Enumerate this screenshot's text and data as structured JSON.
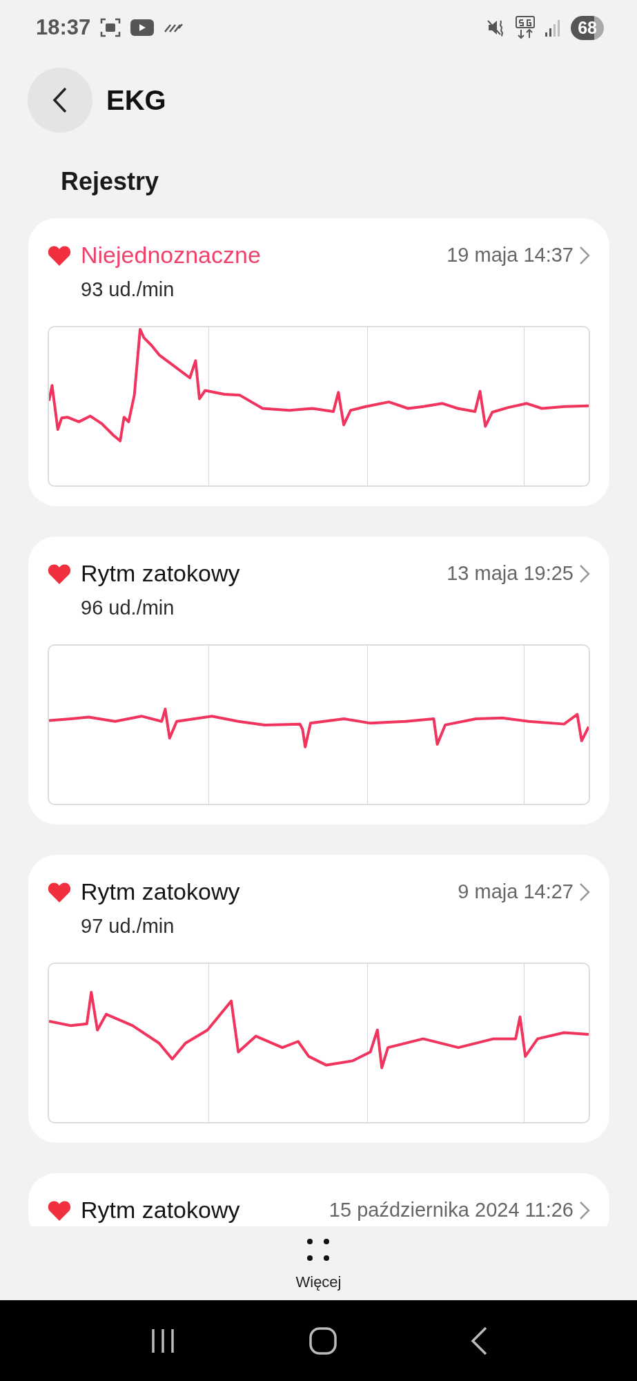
{
  "status_bar": {
    "time": "18:37",
    "battery": "68"
  },
  "header": {
    "title": "EKG"
  },
  "section_title": "Rejestry",
  "records": [
    {
      "highlighted": true,
      "title": "Niejednoznaczne",
      "date": "19 maja 14:37",
      "rate": "93 ud./min"
    },
    {
      "highlighted": false,
      "title": "Rytm zatokowy",
      "date": "13 maja 19:25",
      "rate": "96 ud./min"
    },
    {
      "highlighted": false,
      "title": "Rytm zatokowy",
      "date": "9 maja 14:27",
      "rate": "97 ud./min"
    },
    {
      "highlighted": false,
      "title": "Rytm zatokowy",
      "date": "15 października 2024 11:26"
    }
  ],
  "more": {
    "label": "Więcej"
  }
}
